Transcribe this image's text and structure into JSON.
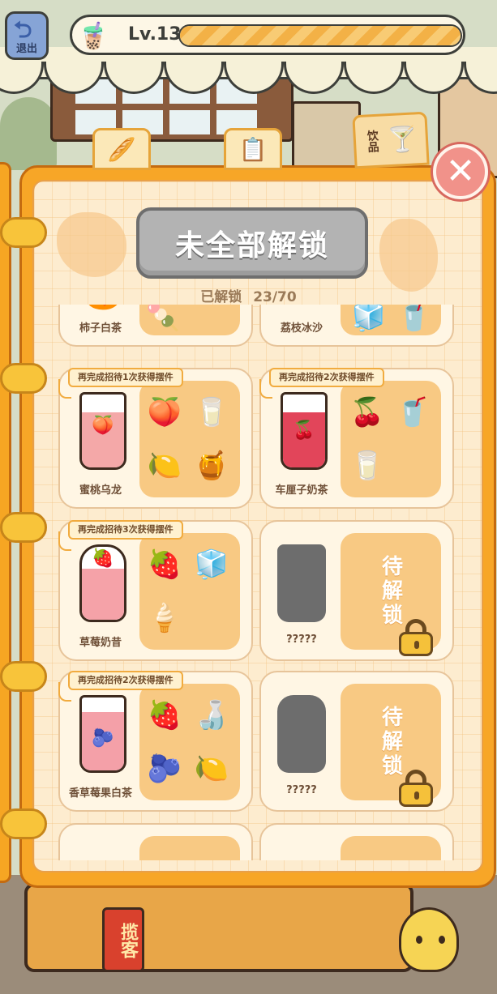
{
  "hud": {
    "back_label": "退出",
    "level_label": "Lv.13",
    "level_progress": 1.0
  },
  "tabs": [
    {
      "icon": "bread-icon",
      "glyph": "🥖"
    },
    {
      "icon": "menu-list-icon",
      "glyph": "📋"
    },
    {
      "icon": "drink-icon",
      "label": "饮品",
      "glyph": "🍸"
    }
  ],
  "close_icon": "close-icon",
  "book": {
    "status_banner": "未全部解锁",
    "unlocked_label": "已解锁",
    "unlocked_count": "23/70"
  },
  "recipes": [
    {
      "name": "柿子白茶",
      "state": "unlocked",
      "task": "",
      "liquid": "#f6b04a",
      "fruit": "🍊",
      "ingredients": [
        "🍡"
      ]
    },
    {
      "name": "荔枝冰沙",
      "state": "unlocked",
      "task": "",
      "liquid": "#ffffff",
      "fruit": "🍒",
      "ingredients": [
        "🧊",
        "🥤"
      ]
    },
    {
      "name": "蜜桃乌龙",
      "state": "unlocked",
      "task": "再完成招待1次获得摆件",
      "liquid": "#f4a8a8",
      "fruit": "🍑",
      "ingredients": [
        "🍑",
        "🥛",
        "🍋",
        "🍯"
      ]
    },
    {
      "name": "车厘子奶茶",
      "state": "unlocked",
      "task": "再完成招待2次获得摆件",
      "liquid": "#e2455a",
      "fruit": "🍒",
      "ingredients": [
        "🍒",
        "🥤",
        "🥛"
      ]
    },
    {
      "name": "草莓奶昔",
      "state": "unlocked",
      "task": "再完成招待3次获得摆件",
      "liquid": "#f5a2a8",
      "fruit": "🍓",
      "ingredients": [
        "🍓",
        "🧊",
        "🍦"
      ]
    },
    {
      "name": "?????",
      "state": "locked",
      "task": "",
      "locked_label": "待解锁"
    },
    {
      "name": "香草莓果白茶",
      "state": "unlocked",
      "task": "再完成招待2次获得摆件",
      "liquid": "#f4a0a8",
      "fruit": "🫐",
      "ingredients": [
        "🍓",
        "🍶",
        "🫐",
        "🍋"
      ]
    },
    {
      "name": "?????",
      "state": "locked",
      "task": "",
      "locked_label": "待解锁"
    },
    {
      "name": "",
      "state": "partial",
      "task": "",
      "ingredients": []
    },
    {
      "name": "",
      "state": "partial",
      "task": "",
      "ingredients": []
    }
  ],
  "background": {
    "tout_sign": "揽客"
  },
  "colors": {
    "book_orange": "#f7a627",
    "card_bg": "#fff6e4",
    "ingredient_panel": "#f8c983",
    "locked_banner": "#b3b3b3",
    "close_button": "#f1928a"
  }
}
